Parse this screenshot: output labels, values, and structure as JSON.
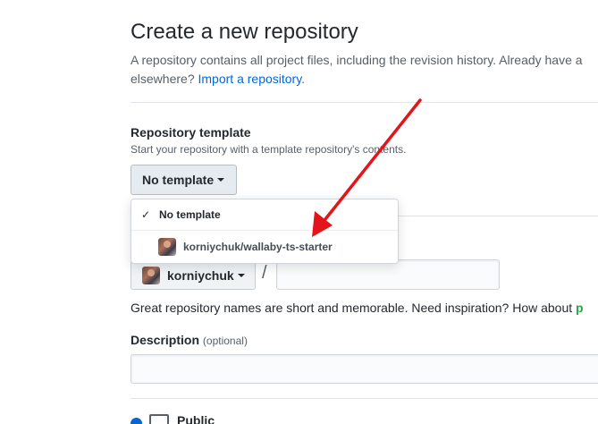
{
  "header": {
    "title": "Create a new repository",
    "intro_line1": "A repository contains all project files, including the revision history. Already have a",
    "intro_line2_prefix": "elsewhere?",
    "import_link": "Import a repository",
    "intro_line2_suffix": "."
  },
  "template_section": {
    "label": "Repository template",
    "note": "Start your repository with a template repository's contents.",
    "button_label": "No template",
    "menu": {
      "items": [
        {
          "label": "No template",
          "selected": true
        },
        {
          "label": "korniychuk/wallaby-ts-starter",
          "selected": false
        }
      ]
    }
  },
  "owner_section": {
    "owner_label": "korniychuk",
    "separator": "/",
    "repo_name_value": ""
  },
  "help": {
    "text": "Great repository names are short and memorable. Need inspiration? How about ",
    "suggestion": "p"
  },
  "description": {
    "label": "Description",
    "optional": "(optional)",
    "value": ""
  },
  "visibility": {
    "public_label": "Public"
  },
  "colors": {
    "link": "#0366d6",
    "annotation_arrow": "#e3151b",
    "suggestion": "#28a745"
  },
  "icons": {
    "check": "check-icon",
    "caret": "caret-down-icon",
    "repo": "repo-icon"
  }
}
